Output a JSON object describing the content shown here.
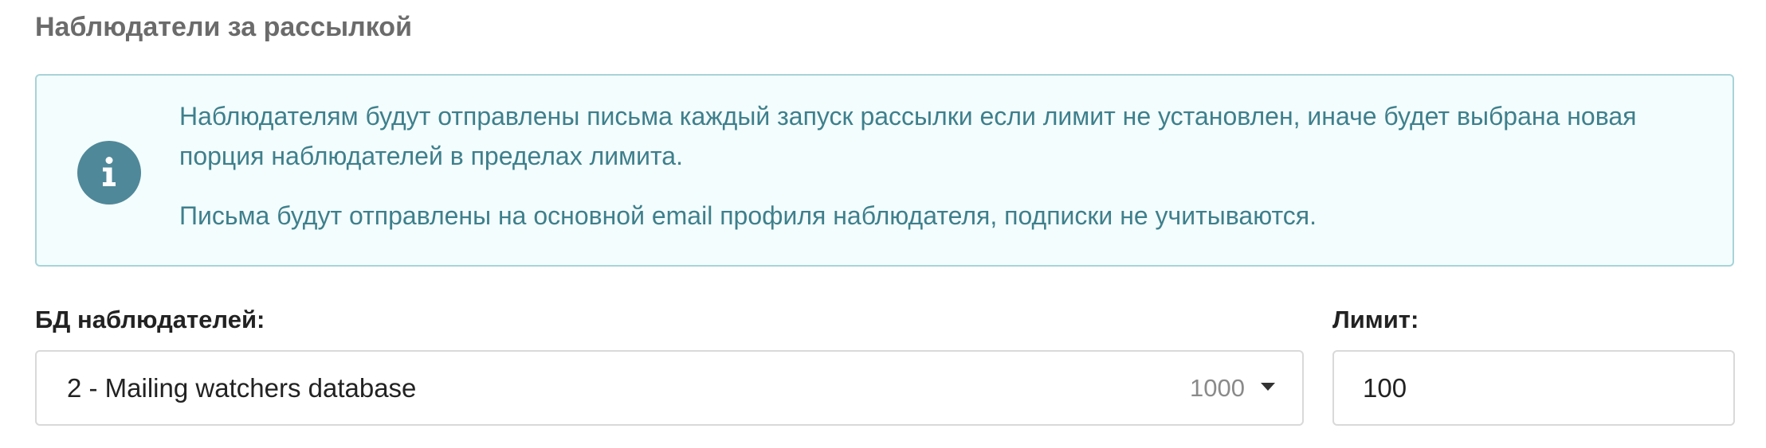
{
  "section": {
    "title": "Наблюдатели за рассылкой"
  },
  "info": {
    "icon": "info-icon",
    "paragraph1": "Наблюдателям будут отправлены письма каждый запуск рассылки если лимит не установлен, иначе будет выбрана новая порция наблюдателей в пределах лимита.",
    "paragraph2": "Письма будут отправлены на основной email профиля наблюдателя, подписки не учитываются.",
    "accent_color": "#4f8899",
    "text_color": "#3e7f8c",
    "background_color": "#f3fdfd"
  },
  "watchers_db": {
    "label": "БД наблюдателей:",
    "selected": "2 - Mailing watchers database",
    "count": "1000",
    "caret_icon": "caret-down-icon"
  },
  "limit": {
    "label": "Лимит:",
    "value": "100"
  }
}
